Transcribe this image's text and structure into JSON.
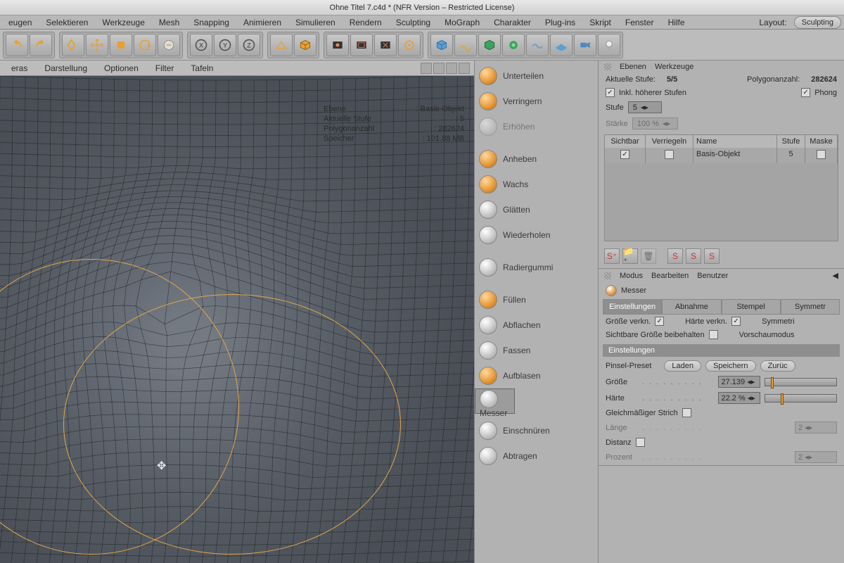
{
  "titlebar": "Ohne Titel 7.c4d * (NFR Version – Restricted License)",
  "menu": [
    "eugen",
    "Selektieren",
    "Werkzeuge",
    "Mesh",
    "Snapping",
    "Animieren",
    "Simulieren",
    "Rendern",
    "Sculpting",
    "MoGraph",
    "Charakter",
    "Plug-ins",
    "Skript",
    "Fenster",
    "Hilfe"
  ],
  "layout_label": "Layout:",
  "layout_value": "Sculpting",
  "view_menu": [
    "eras",
    "Darstellung",
    "Optionen",
    "Filter",
    "Tafeln"
  ],
  "hud": {
    "ebene_k": "Ebene",
    "ebene_v": "Basis-Objekt",
    "stufe_k": "Aktuelle Stufe",
    "stufe_v": "5",
    "poly_k": "Polygonanzahl",
    "poly_v": "282624",
    "mem_k": "Speicher",
    "mem_v": "101.88 MB"
  },
  "tool_panel": {
    "items": [
      {
        "label": "Unterteilen"
      },
      {
        "label": "Verringern"
      },
      {
        "label": "Erhöhen"
      }
    ],
    "brushes": [
      {
        "label": "Anheben"
      },
      {
        "label": "Wachs"
      },
      {
        "label": "Glätten"
      },
      {
        "label": "Wiederholen"
      },
      {
        "label": "Radiergummi"
      },
      {
        "label": "Füllen"
      },
      {
        "label": "Abflachen"
      },
      {
        "label": "Fassen"
      },
      {
        "label": "Aufblasen"
      },
      {
        "label": "Messer"
      },
      {
        "label": "Einschnüren"
      },
      {
        "label": "Abtragen"
      }
    ],
    "selected": "Messer"
  },
  "right": {
    "head1": [
      "Ebenen",
      "Werkzeuge"
    ],
    "stufe_label": "Aktuelle Stufe:",
    "stufe_value": "5/5",
    "poly_label": "Polygonanzahl:",
    "poly_value": "282624",
    "inkl": "Inkl. höherer Stufen",
    "phong": "Phong",
    "stufe_sel_label": "Stufe",
    "stufe_sel_value": "5",
    "staerke_label": "Stärke",
    "staerke_value": "100 %",
    "tbl_head": [
      "Sichtbar",
      "Verriegeln",
      "Name",
      "Stufe",
      "Maske"
    ],
    "tbl_row": {
      "name": "Basis-Objekt",
      "stufe": "5"
    },
    "head2": [
      "Modus",
      "Bearbeiten",
      "Benutzer"
    ],
    "attr_title": "Messer",
    "tabs": [
      "Einstellungen",
      "Abnahme",
      "Stempel",
      "Symmetr"
    ],
    "groesse_verkn": "Größe verkn.",
    "haerte_verkn": "Härte verkn.",
    "symm": "Symmetri",
    "sichtbare": "Sichtbare Größe beibehalten",
    "vorschau": "Vorschaumodus",
    "section": "Einstellungen",
    "preset_label": "Pinsel-Preset",
    "btn_laden": "Laden",
    "btn_speichern": "Speichern",
    "btn_zurueck": "Zurüc",
    "groesse_label": "Größe",
    "groesse_value": "27.139",
    "haerte_label": "Härte",
    "haerte_value": "22.2 %",
    "gleich": "Gleichmäßiger Strich",
    "laenge_label": "Länge",
    "laenge_value": "2",
    "distanz_label": "Distanz",
    "prozent_label": "Prozent",
    "prozent_value": "2"
  }
}
